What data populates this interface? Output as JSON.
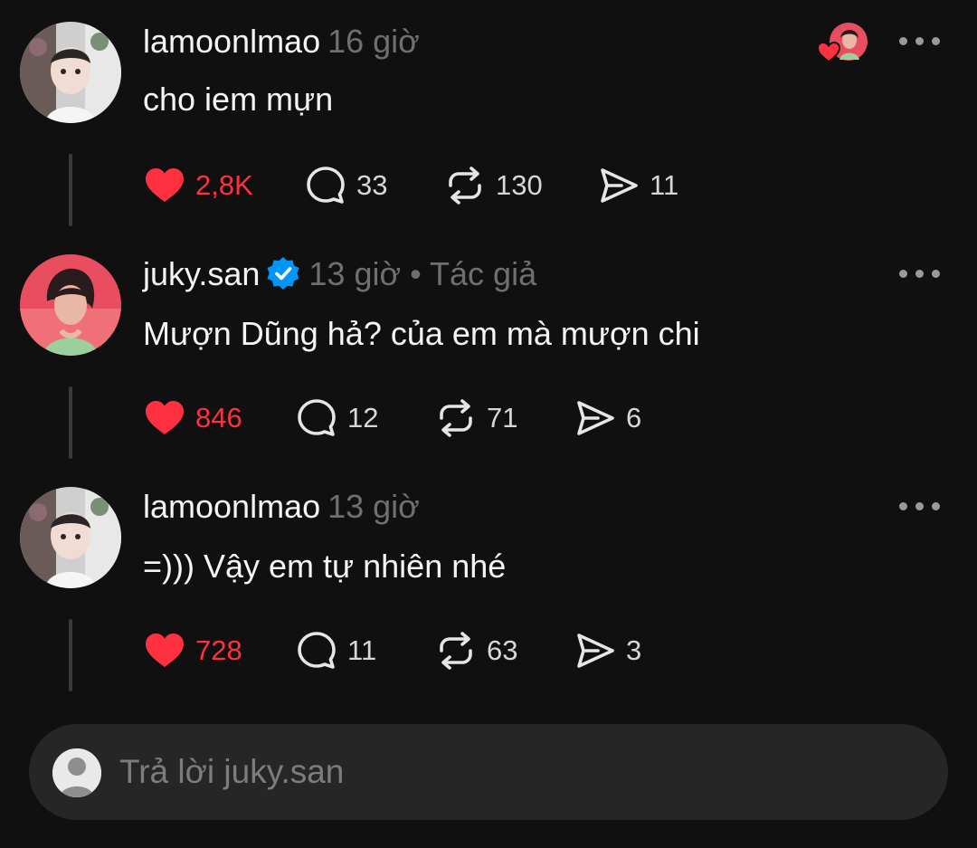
{
  "colors": {
    "background": "#101010",
    "like": "#ff3040",
    "verified": "#0095f6",
    "muted": "#6f6f6f"
  },
  "comments": [
    {
      "username": "lamoonlmao",
      "time": "16 giờ",
      "text": "cho iem mựn",
      "likes": "2,8K",
      "replies": "33",
      "reposts": "130",
      "shares": "11",
      "liked": true,
      "has_reaction_avatar": true
    },
    {
      "username": "juky.san",
      "verified": true,
      "time": "13 giờ • Tác giả",
      "text": "Mượn Dũng hả? của em mà mượn chi",
      "likes": "846",
      "replies": "12",
      "reposts": "71",
      "shares": "6",
      "liked": true
    },
    {
      "username": "lamoonlmao",
      "time": "13 giờ",
      "text": "=))) Vậy em tự nhiên nhé",
      "likes": "728",
      "replies": "11",
      "reposts": "63",
      "shares": "3",
      "liked": true
    }
  ],
  "reply_box": {
    "placeholder": "Trả lời juky.san"
  },
  "icons": [
    "heart-icon",
    "comment-icon",
    "repost-icon",
    "share-icon",
    "more-icon",
    "verified-icon",
    "user-icon"
  ]
}
